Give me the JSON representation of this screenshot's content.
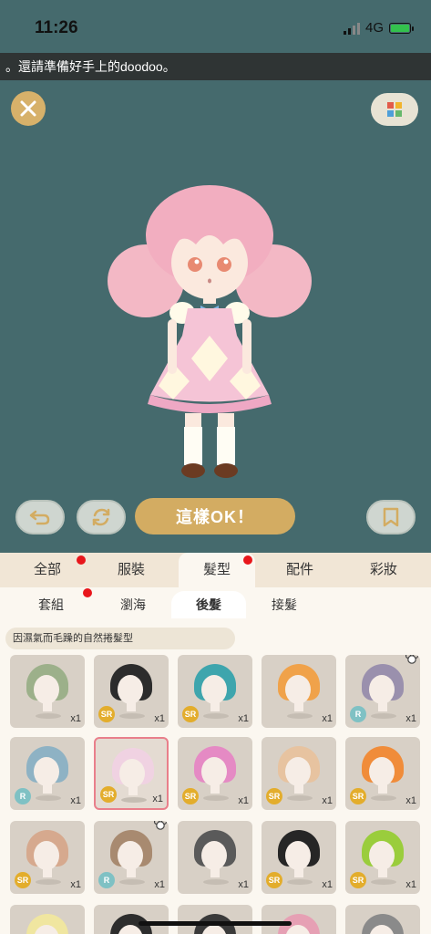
{
  "status_bar": {
    "time": "11:26",
    "network": "4G"
  },
  "marquee": {
    "text": "。還請準備好手上的doodoo。"
  },
  "controls": {
    "ok_label": "這樣OK！"
  },
  "tabs": [
    {
      "label": "全部",
      "dot": true
    },
    {
      "label": "服裝",
      "dot": false
    },
    {
      "label": "髮型",
      "dot": true,
      "active": true
    },
    {
      "label": "配件",
      "dot": false
    },
    {
      "label": "彩妝",
      "dot": false
    }
  ],
  "subtabs": [
    {
      "label": "套組",
      "dot": true
    },
    {
      "label": "瀏海",
      "dot": false
    },
    {
      "label": "後髮",
      "active": true
    },
    {
      "label": "接髮",
      "dot": false
    }
  ],
  "description": "因濕氣而毛躁的自然捲髮型",
  "items": [
    {
      "hair": "#9cb08a",
      "rarity": "",
      "qty": "x1"
    },
    {
      "hair": "#2c2c2c",
      "rarity": "SR",
      "qty": "x1"
    },
    {
      "hair": "#3ea5ad",
      "rarity": "SR",
      "qty": "x1"
    },
    {
      "hair": "#f0a24a",
      "rarity": "",
      "qty": "x1"
    },
    {
      "hair": "#9a90ad",
      "rarity": "R",
      "qty": "x1",
      "bear": true
    },
    {
      "hair": "#8eb2c4",
      "rarity": "R",
      "qty": "x1"
    },
    {
      "hair": "#f0d2e2",
      "rarity": "SR",
      "qty": "x1",
      "selected": true
    },
    {
      "hair": "#e58ac4",
      "rarity": "SR",
      "qty": "x1"
    },
    {
      "hair": "#e7c3a0",
      "rarity": "SR",
      "qty": "x1"
    },
    {
      "hair": "#f08c3a",
      "rarity": "SR",
      "qty": "x1"
    },
    {
      "hair": "#d6a98e",
      "rarity": "SR",
      "qty": "x1"
    },
    {
      "hair": "#a88a70",
      "rarity": "R",
      "qty": "x1",
      "bear": true
    },
    {
      "hair": "#5a5a5a",
      "rarity": "",
      "qty": "x1"
    },
    {
      "hair": "#262626",
      "rarity": "SR",
      "qty": "x1"
    },
    {
      "hair": "#9acd3c",
      "rarity": "SR",
      "qty": "x1"
    },
    {
      "hair": "#f0e6a0",
      "rarity": "",
      "qty": ""
    },
    {
      "hair": "#2d2d2d",
      "rarity": "",
      "qty": ""
    },
    {
      "hair": "#3a3a3a",
      "rarity": "",
      "qty": ""
    },
    {
      "hair": "#e6a0b4",
      "rarity": "",
      "qty": ""
    },
    {
      "hair": "#8a8a8a",
      "rarity": "",
      "qty": ""
    }
  ]
}
